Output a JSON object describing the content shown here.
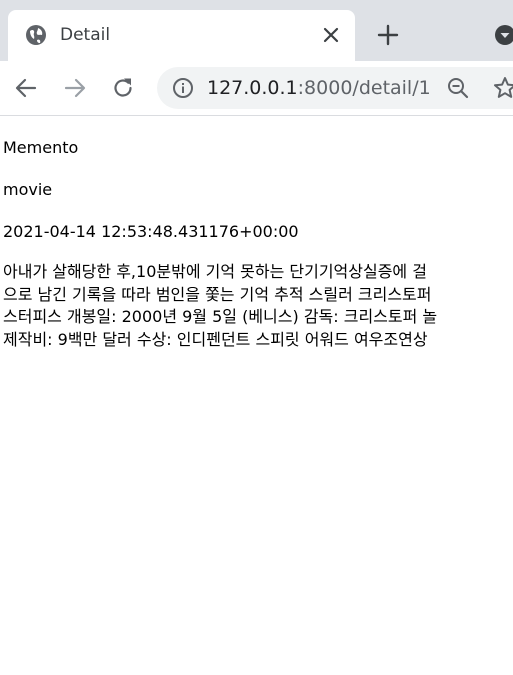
{
  "tab": {
    "title": "Detail",
    "favicon": "globe-icon",
    "close_icon": "close-icon"
  },
  "tabstrip": {
    "new_tab_icon": "plus-icon",
    "tab_search_icon": "chevron-down-icon"
  },
  "toolbar": {
    "back_icon": "arrow-left-icon",
    "forward_icon": "arrow-right-icon",
    "reload_icon": "reload-icon",
    "site_info_icon": "info-icon",
    "url_host": "127.0.0.1",
    "url_path": ":8000/detail/1",
    "zoom_icon": "zoom-out-icon",
    "bookmark_icon": "star-icon"
  },
  "detail": {
    "title": "Memento",
    "category": "movie",
    "timestamp": "2021-04-14 12:53:48.431176+00:00",
    "summary_lines": [
      "아내가 살해당한 후,10분밖에 기억 못하는 단기기억상실증에 걸",
      "으로 남긴 기록을 따라 범인을 쫓는 기억 추적 스릴러 크리스토퍼",
      "스터피스 개봉일: 2000년 9월 5일 (베니스) 감독: 크리스토퍼 놀",
      "제작비: 9백만 달러 수상: 인디펜던트 스피릿 어워드 여우조연상"
    ]
  },
  "colors": {
    "tabstrip_bg": "#dee1e6",
    "omnibox_bg": "#f1f3f4",
    "icon": "#5f6368",
    "icon_disabled": "#9aa0a6"
  }
}
